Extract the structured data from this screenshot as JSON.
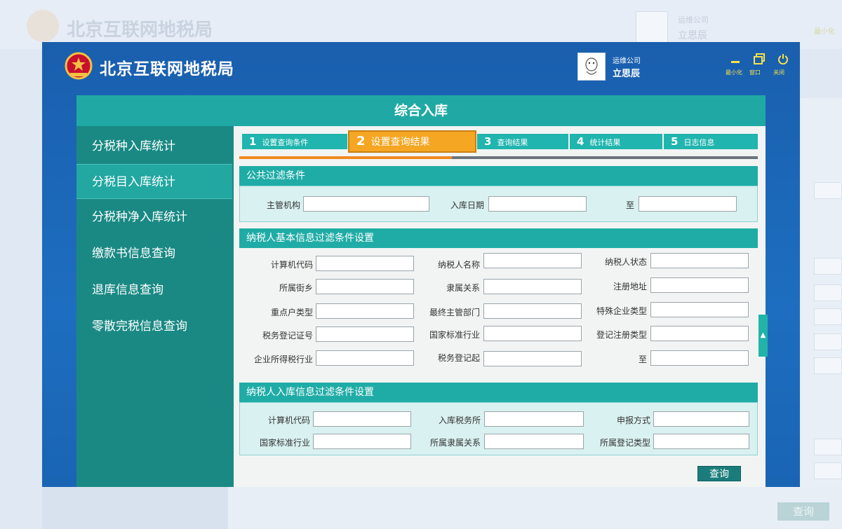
{
  "app": {
    "title": "北京互联网地税局",
    "company": "运维公司",
    "username": "立思辰"
  },
  "window_controls": {
    "minimize": "最小化",
    "restore": "窗口",
    "close": "关闭"
  },
  "panel": {
    "title": "综合入库"
  },
  "sidebar": {
    "items": [
      {
        "label": "分税种入库统计"
      },
      {
        "label": "分税目入库统计"
      },
      {
        "label": "分税种净入库统计"
      },
      {
        "label": "缴款书信息查询"
      },
      {
        "label": "退库信息查询"
      },
      {
        "label": "零散完税信息查询"
      }
    ],
    "active_index": 1
  },
  "steps": [
    {
      "num": "1",
      "label": "设置查询条件"
    },
    {
      "num": "2",
      "label": "设置查询结果"
    },
    {
      "num": "3",
      "label": "查询结果"
    },
    {
      "num": "4",
      "label": "统计结果"
    },
    {
      "num": "5",
      "label": "日志信息"
    }
  ],
  "active_step": 2,
  "progress": 0.41,
  "sections": {
    "public": {
      "title": "公共过滤条件",
      "fields": [
        "主管机构",
        "入库日期",
        "至"
      ]
    },
    "taxpayer_basic": {
      "title": "纳税人基本信息过滤条件设置",
      "fields": [
        "计算机代码",
        "纳税人名称",
        "纳税人状态",
        "所属街乡",
        "隶属关系",
        "注册地址",
        "重点户类型",
        "最终主管部门",
        "特殊企业类型",
        "税务登记证号",
        "国家标准行业",
        "登记注册类型",
        "企业所得税行业",
        "税务登记起",
        "至"
      ]
    },
    "taxpayer_storage": {
      "title": "纳税人入库信息过滤条件设置",
      "fields": [
        "计算机代码",
        "入库税务所",
        "申报方式",
        "国家标准行业",
        "所属隶属关系",
        "所属登记类型"
      ]
    }
  },
  "query_button": "查询",
  "background": {
    "title": "北京互联网地税局",
    "company": "运维公司",
    "username": "立思辰",
    "minimize": "最小化",
    "query_button": "查询"
  },
  "colors": {
    "window_blue": "#1a5fae",
    "teal": "#20aca6",
    "teal_dark": "#1a8984",
    "active_step": "#f5a623",
    "progress": "#f08a1f"
  }
}
